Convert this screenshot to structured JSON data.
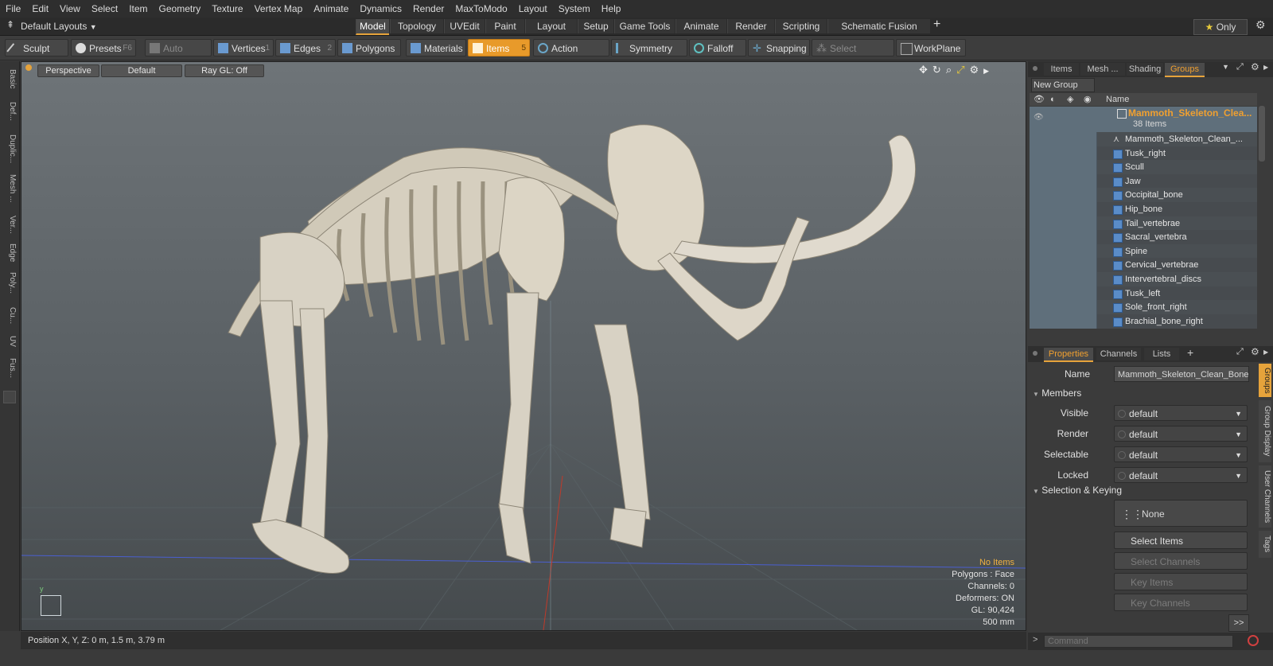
{
  "menu": [
    "File",
    "Edit",
    "View",
    "Select",
    "Item",
    "Geometry",
    "Texture",
    "Vertex Map",
    "Animate",
    "Dynamics",
    "Render",
    "MaxToModo",
    "Layout",
    "System",
    "Help"
  ],
  "layout_selector": "Default Layouts",
  "layout_tabs": [
    "Model",
    "Topology",
    "UVEdit",
    "Paint",
    "Layout",
    "Setup",
    "Game Tools",
    "Animate",
    "Render",
    "Scripting",
    "Schematic Fusion"
  ],
  "active_layout_tab": "Model",
  "only_label": "Only",
  "toolbar": {
    "sculpt": "Sculpt",
    "presets": "Presets",
    "presets_key": "F6",
    "auto_select": "Auto Select",
    "vertices": "Vertices",
    "vertices_key": "1",
    "edges": "Edges",
    "edges_key": "2",
    "polygons": "Polygons",
    "materials": "Materials",
    "items": "Items",
    "items_key": "5",
    "action_center": "Action Center",
    "symmetry": "Symmetry",
    "falloff": "Falloff",
    "snapping": "Snapping",
    "select_through": "Select Through",
    "workplane": "WorkPlane"
  },
  "left_tabs": [
    "Basic",
    "Def...",
    "Duplic...",
    "Mesh ...",
    "Ver...",
    "Edge",
    "Poly...",
    "Cu...",
    "UV",
    "Fus..."
  ],
  "viewport": {
    "view": "Perspective",
    "style": "Default",
    "raygl": "Ray GL: Off",
    "info": {
      "no_items": "No Items",
      "polygons": "Polygons : Face",
      "channels": "Channels: 0",
      "deformers": "Deformers: ON",
      "gl": "GL: 90,424",
      "scale": "500 mm"
    }
  },
  "status": {
    "position": "Position X, Y, Z:   0 m, 1.5 m, 3.79 m"
  },
  "panel_top": {
    "tabs": [
      "Items",
      "Mesh ...",
      "Shading",
      "Groups"
    ],
    "active_tab": "Groups",
    "new_group": "New Group",
    "column_name": "Name",
    "group_name": "Mammoth_Skeleton_Clea...",
    "group_count": "38 Items",
    "items": [
      "Mammoth_Skeleton_Clean_...",
      "Tusk_right",
      "Scull",
      "Jaw",
      "Occipital_bone",
      "Hip_bone",
      "Tail_vertebrae",
      "Sacral_vertebra",
      "Spine",
      "Cervical_vertebrae",
      "Intervertebral_discs",
      "Tusk_left",
      "Sole_front_right",
      "Brachial_bone_right"
    ]
  },
  "panel_bottom": {
    "tabs": [
      "Properties",
      "Channels",
      "Lists"
    ],
    "active_tab": "Properties",
    "name_label": "Name",
    "name_value": "Mammoth_Skeleton_Clean_Bones",
    "members_section": "Members",
    "visible_label": "Visible",
    "render_label": "Render",
    "selectable_label": "Selectable",
    "locked_label": "Locked",
    "dropdown_value": "default",
    "selection_section": "Selection & Keying",
    "none_label": "None",
    "select_items": "Select Items",
    "select_channels": "Select Channels",
    "key_items": "Key Items",
    "key_channels": "Key Channels",
    "more": ">>",
    "side_tabs": [
      "Groups",
      "Group Display",
      "User Channels",
      "Tags"
    ]
  },
  "command_placeholder": "Command",
  "colors": {
    "accent": "#e6a33b",
    "active_button": "#e89a2a",
    "list_highlight": "#5f6f7b"
  }
}
